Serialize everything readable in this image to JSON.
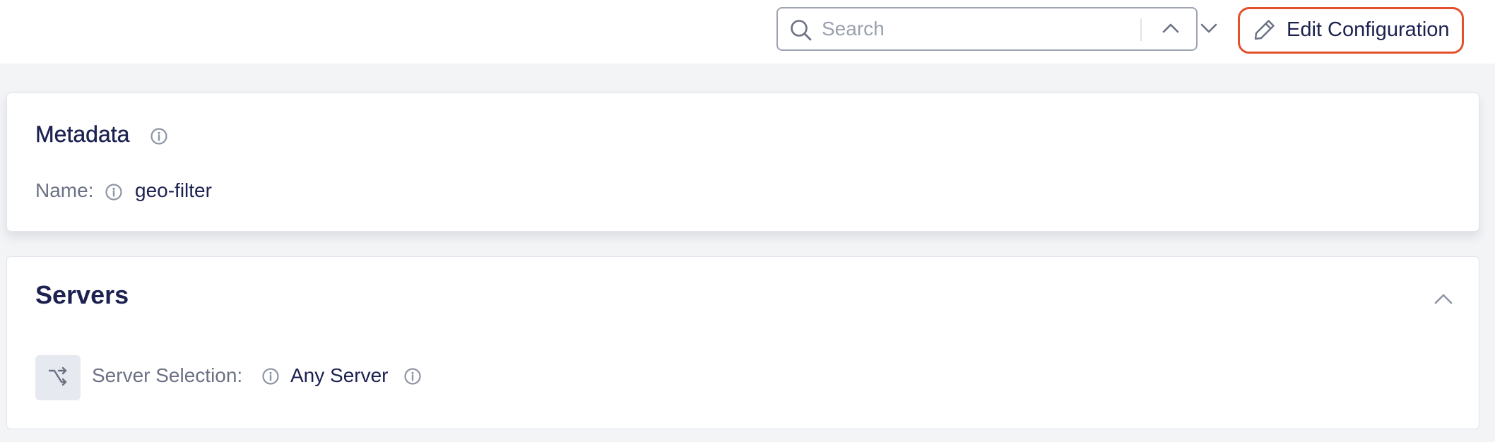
{
  "search": {
    "placeholder": "Search",
    "value": ""
  },
  "toolbar": {
    "edit_label": "Edit Configuration"
  },
  "metadata": {
    "title": "Metadata",
    "name_label": "Name:",
    "name_value": "geo-filter"
  },
  "servers": {
    "title": "Servers",
    "selection_label": "Server Selection:",
    "selection_value": "Any Server"
  },
  "colors": {
    "accent_border": "#e3512c",
    "text_primary": "#1c2150",
    "text_muted": "#6b7183",
    "page_background": "#f3f4f6"
  },
  "icons": {
    "search": "search-icon",
    "previous": "chevron-up-icon",
    "next": "chevron-down-icon",
    "clear": "close-icon",
    "edit": "pencil-icon",
    "info": "info-icon",
    "collapse": "chevron-up-icon",
    "route": "route-split-icon"
  }
}
